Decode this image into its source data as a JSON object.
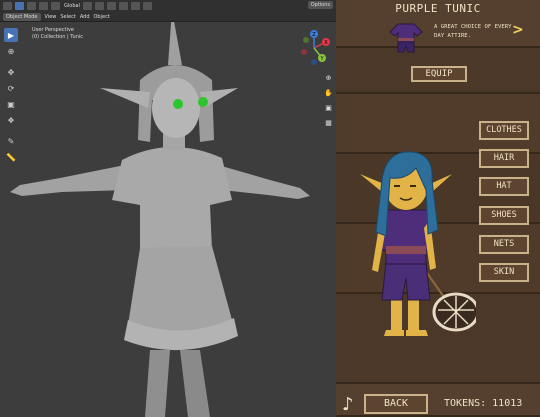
{
  "blender": {
    "header": {
      "mode": "Object Mode",
      "menus": [
        "View",
        "Select",
        "Add",
        "Object"
      ],
      "transform": "Global",
      "options": "Options"
    },
    "viewport": {
      "view_name": "User Perspective",
      "collection": "(0) Collection | Tunic"
    },
    "gizmo_axes": {
      "x": "X",
      "y": "Y",
      "z": "Z"
    },
    "colors": {
      "x_axis": "#e2384a",
      "y_axis": "#89c33f",
      "z_axis": "#3b7ed9",
      "accent": "#4772b3"
    }
  },
  "game": {
    "item": {
      "name": "PURPLE TUNIC",
      "description": "A GREAT CHOICE OF EVERY DAY ATTIRE.",
      "icon": "purple-tunic-icon"
    },
    "equip_label": "EQUIP",
    "categories": [
      "CLOTHES",
      "HAIR",
      "HAT",
      "SHOES",
      "NETS",
      "SKIN"
    ],
    "back_label": "BACK",
    "tokens": "TOKENS: 11013",
    "colors": {
      "wood": "#4e3a2a",
      "button_border": "#c9b18a",
      "text": "#f1e3c3",
      "arrow": "#f4d25c"
    }
  }
}
